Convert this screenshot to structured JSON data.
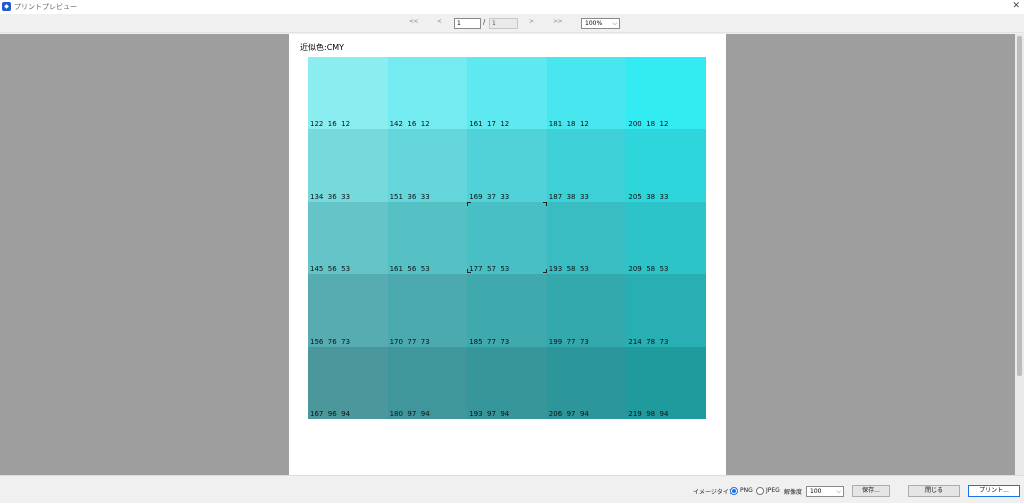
{
  "window": {
    "title": "プリントプレビュー",
    "app_icon": "app-logo-icon",
    "close_icon": "close-icon"
  },
  "nav": {
    "first_label": "<<",
    "prev_label": "<",
    "next_label": ">",
    "last_label": ">>",
    "page_value": "1",
    "page_separator": "/",
    "page_total": "1",
    "zoom_value": "100%",
    "zoom_chevron": "⌵"
  },
  "paper": {
    "title": "近似色:CMY",
    "swatches": [
      [
        {
          "label": "122  16  12",
          "color": "#8aeef1"
        },
        {
          "label": "142  16  12",
          "color": "#74ebf0"
        },
        {
          "label": "161  17  12",
          "color": "#5ee8ef"
        },
        {
          "label": "181  18  12",
          "color": "#48e6ef"
        },
        {
          "label": "200  18  12",
          "color": "#33ebf2"
        }
      ],
      [
        {
          "label": "134  36  33",
          "color": "#76d9dc"
        },
        {
          "label": "151  36  33",
          "color": "#64d6db"
        },
        {
          "label": "169  37  33",
          "color": "#50d2d8"
        },
        {
          "label": "187  38  33",
          "color": "#3ed0d7"
        },
        {
          "label": "205  38  33",
          "color": "#2cd6db"
        }
      ],
      [
        {
          "label": "145  56  53",
          "color": "#64c4c7"
        },
        {
          "label": "161  56  53",
          "color": "#56c1c5"
        },
        {
          "label": "177  57  53",
          "color": "#48bfc4"
        },
        {
          "label": "193  58  53",
          "color": "#3abdc2"
        },
        {
          "label": "209  58  53",
          "color": "#2cc4c8"
        }
      ],
      [
        {
          "label": "156  76  73",
          "color": "#56acb0"
        },
        {
          "label": "170  77  73",
          "color": "#4aaab0"
        },
        {
          "label": "185  77  73",
          "color": "#3fa9ae"
        },
        {
          "label": "199  77  73",
          "color": "#33a8ad"
        },
        {
          "label": "214  78  73",
          "color": "#27afb4"
        }
      ],
      [
        {
          "label": "167  96  94",
          "color": "#4a989b"
        },
        {
          "label": "180  97  94",
          "color": "#40979b"
        },
        {
          "label": "193  97  94",
          "color": "#36969a"
        },
        {
          "label": "206  97  94",
          "color": "#2c969a"
        },
        {
          "label": "219  98  94",
          "color": "#1f9a9d"
        }
      ]
    ]
  },
  "bottom": {
    "image_type_label": "イメージタイプ",
    "png_label": "PNG",
    "jpeg_label": "JPEG",
    "resolution_label": "解像度",
    "resolution_value": "100",
    "resolution_chevron": "⌵",
    "save_label": "保存...",
    "close_label": "閉じる",
    "print_label": "プリント..."
  },
  "colors": {
    "preview_bg": "#9e9e9e",
    "accent": "#1a73e8"
  }
}
